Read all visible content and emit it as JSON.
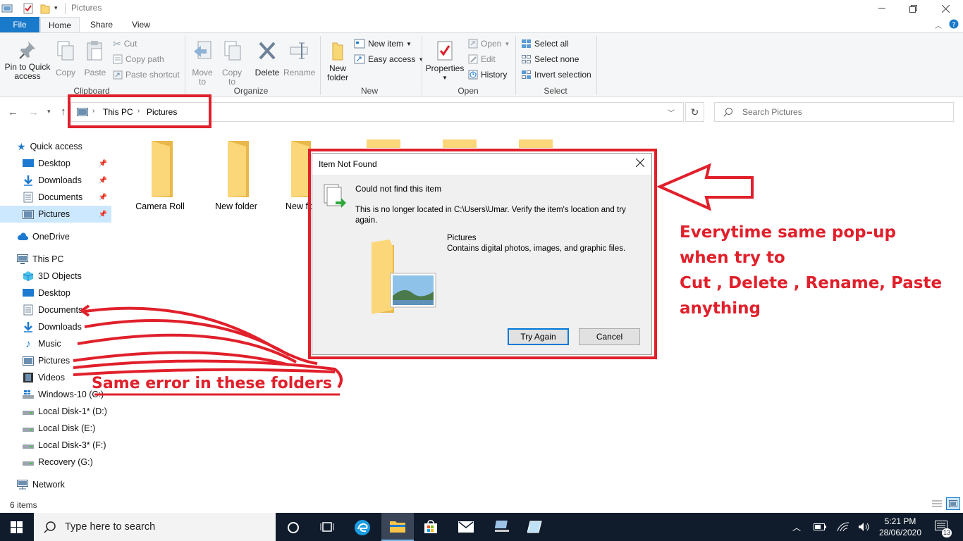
{
  "window": {
    "title": "Pictures",
    "tabs": {
      "file": "File",
      "home": "Home",
      "share": "Share",
      "view": "View"
    }
  },
  "ribbon": {
    "clipboard": {
      "label": "Clipboard",
      "pin": "Pin to Quick access",
      "copy": "Copy",
      "paste": "Paste",
      "cut": "Cut",
      "copy_path": "Copy path",
      "paste_shortcut": "Paste shortcut"
    },
    "organize": {
      "label": "Organize",
      "move_to": "Move to",
      "copy_to": "Copy to",
      "delete": "Delete",
      "rename": "Rename"
    },
    "new": {
      "label": "New",
      "new_folder": "New folder",
      "new_item": "New item",
      "easy_access": "Easy access"
    },
    "open": {
      "label": "Open",
      "properties": "Properties",
      "open": "Open",
      "edit": "Edit",
      "history": "History"
    },
    "select": {
      "label": "Select",
      "select_all": "Select all",
      "select_none": "Select none",
      "invert": "Invert selection"
    }
  },
  "address": {
    "crumbs": [
      "This PC",
      "Pictures"
    ],
    "search_placeholder": "Search Pictures"
  },
  "sidebar": {
    "quick_access": "Quick access",
    "quick_items": [
      "Desktop",
      "Downloads",
      "Documents",
      "Pictures"
    ],
    "onedrive": "OneDrive",
    "this_pc": "This PC",
    "pc_items": [
      "3D Objects",
      "Desktop",
      "Documents",
      "Downloads",
      "Music",
      "Pictures",
      "Videos",
      "Windows-10 (C:)",
      "Local Disk-1* (D:)",
      "Local Disk (E:)",
      "Local Disk-3* (F:)",
      "Recovery (G:)"
    ],
    "network": "Network"
  },
  "content": {
    "folders": [
      "Camera Roll",
      "New folder",
      "New fo"
    ]
  },
  "status": {
    "count": "6 items"
  },
  "dialog": {
    "title": "Item Not Found",
    "heading": "Could not find this item",
    "message": "This is no longer located in C:\\Users\\Umar. Verify the item's location and try again.",
    "item_name": "Pictures",
    "item_desc": "Contains digital photos, images, and graphic files.",
    "try_again": "Try Again",
    "cancel": "Cancel"
  },
  "annotations": {
    "side_text": [
      "Everytime same pop-up",
      "when try to",
      "Cut , Delete , Rename, Paste",
      "anything"
    ],
    "bottom_text": "Same error in these  folders"
  },
  "taskbar": {
    "search_placeholder": "Type here to search",
    "time": "5:21 PM",
    "date": "28/06/2020",
    "notifications": "13"
  },
  "colors": {
    "accent": "#1979ca",
    "annotation": "#e0202b",
    "taskbar": "#101c2c",
    "selected": "#cce8ff"
  }
}
